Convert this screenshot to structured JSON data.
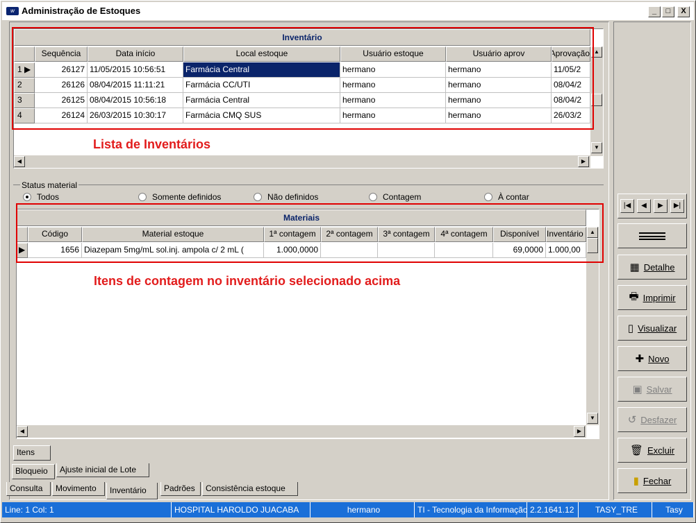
{
  "window": {
    "title": "Administração de Estoques",
    "app_icon": "app-logo-icon"
  },
  "caption_buttons": {
    "minimize": "_",
    "maximize": "□",
    "close": "X"
  },
  "inventario": {
    "title": "Inventário",
    "columns": [
      "Sequência",
      "Data início",
      "Local estoque",
      "Usuário estoque",
      "Usuário aprov",
      "Aprovação"
    ],
    "rows": [
      {
        "ind": "1",
        "seq": "26127",
        "data": "11/05/2015 10:56:51",
        "local": "Farmácia Central",
        "usuario": "hermano",
        "aprov": "hermano",
        "aprovacao": "11/05/2"
      },
      {
        "ind": "2",
        "seq": "26126",
        "data": "08/04/2015 11:11:21",
        "local": "Farmácia CC/UTI",
        "usuario": "hermano",
        "aprov": "hermano",
        "aprovacao": "08/04/2"
      },
      {
        "ind": "3",
        "seq": "26125",
        "data": "08/04/2015 10:56:18",
        "local": "Farmácia Central",
        "usuario": "hermano",
        "aprov": "hermano",
        "aprovacao": "08/04/2"
      },
      {
        "ind": "4",
        "seq": "26124",
        "data": "26/03/2015 10:30:17",
        "local": "Farmácia CMQ SUS",
        "usuario": "hermano",
        "aprov": "hermano",
        "aprovacao": "26/03/2"
      }
    ]
  },
  "annotations": {
    "lista": "Lista de Inventários",
    "itens": "Itens de contagem no inventário selecionado acima"
  },
  "status_material": {
    "legend": "Status material",
    "options": [
      "Todos",
      "Somente definidos",
      "Não definidos",
      "Contagem",
      "À contar"
    ],
    "selected": "Todos"
  },
  "materiais": {
    "title": "Materiais",
    "columns": [
      "Código",
      "Material estoque",
      "1ª contagem",
      "2ª contagem",
      "3ª contagem",
      "4ª contagem",
      "Disponível",
      "Inventário"
    ],
    "rows": [
      {
        "codigo": "1656",
        "material": "Diazepam 5mg/mL sol.inj. ampola c/ 2 mL  (",
        "c1": "1.000,0000",
        "c2": "",
        "c3": "",
        "c4": "",
        "disp": "69,0000",
        "inv": "1.000,00"
      }
    ]
  },
  "nav": {
    "first": "first-record-icon",
    "prev": "prev-record-icon",
    "next": "next-record-icon",
    "last": "last-record-icon"
  },
  "side_buttons": [
    {
      "label": "Detalhe",
      "icon": "table-icon",
      "enabled": true
    },
    {
      "label": "Imprimir",
      "icon": "printer-icon",
      "enabled": true
    },
    {
      "label": "Visualizar",
      "icon": "document-icon",
      "enabled": true
    },
    {
      "label": "Novo",
      "icon": "new-document-icon",
      "enabled": true
    },
    {
      "label": "Salvar",
      "icon": "save-icon",
      "enabled": false
    },
    {
      "label": "Desfazer",
      "icon": "undo-icon",
      "enabled": false
    },
    {
      "label": "Excluir",
      "icon": "trash-icon",
      "enabled": true
    },
    {
      "label": "Fechar",
      "icon": "door-icon",
      "enabled": true
    }
  ],
  "tabs": {
    "inner": "Itens",
    "middle": [
      "Bloqueio",
      "Ajuste inicial de Lote"
    ],
    "bottom": [
      "Consulta",
      "Movimento",
      "Inventário",
      "Padrões",
      "Consistência estoque"
    ]
  },
  "statusbar": {
    "line": "Line:  1  Col:  1",
    "hospital": "HOSPITAL HAROLDO JUACABA",
    "user": "hermano",
    "dept": "TI - Tecnologia da Informação",
    "version": "2.2.1641.12",
    "db": "TASY_TRE",
    "app": "Tasy"
  },
  "colors": {
    "selection": "#0a246a",
    "annotation": "#e21c1c",
    "statusbar": "#1a6fd8",
    "header_text": "#000080"
  }
}
